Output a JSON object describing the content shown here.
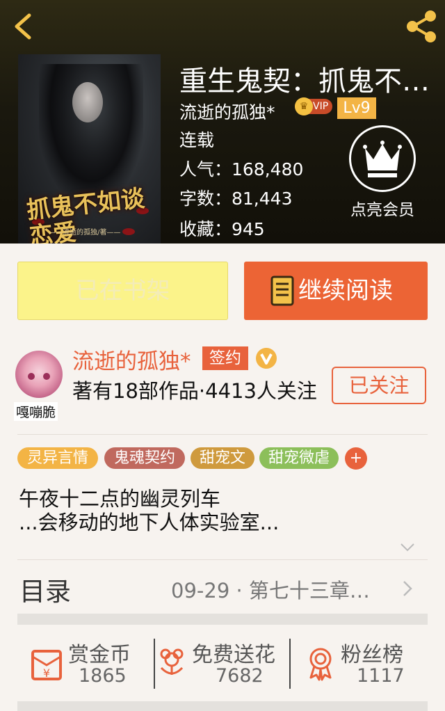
{
  "header": {
    "back_icon": "chevron-left-icon",
    "share_icon": "share-icon"
  },
  "book": {
    "title": "重生鬼契：抓鬼不…",
    "author": "流逝的孤独*",
    "vip_label": "VIP",
    "level": "Lv9",
    "status": "连载",
    "popularity": "人气：168,480",
    "word_count": "字数：81,443",
    "favorites": "收藏：945",
    "cover_title": "抓鬼不如谈恋爱",
    "cover_author": "——流逝的孤独/著——",
    "member_label": "点亮会员"
  },
  "actions": {
    "shelf_label": "已在书架",
    "read_label": "继续阅读"
  },
  "author_card": {
    "avatar_name": "嘎嘣脆",
    "name": "流逝的孤独*",
    "sign_label": "签约",
    "works_text": "著有18部作品·4413人关注",
    "follow_label": "已关注"
  },
  "tags": [
    {
      "label": "灵异言情",
      "color": "#f3b445"
    },
    {
      "label": "鬼魂契约",
      "color": "#c0695e"
    },
    {
      "label": "甜宠文",
      "color": "#cf9a3d"
    },
    {
      "label": "甜宠微虐",
      "color": "#8cbf5a"
    }
  ],
  "tag_more": "+",
  "description": {
    "line1": "午夜十二点的幽灵列车",
    "line2": "...会移动的地下人体实验室..."
  },
  "catalog": {
    "label": "目录",
    "latest": "09-29 · 第七十三章…"
  },
  "bottom_stats": [
    {
      "label": "赏金币",
      "value": "1865",
      "icon": "coin-envelope-icon"
    },
    {
      "label": "免费送花",
      "value": "7682",
      "icon": "flower-icon"
    },
    {
      "label": "粉丝榜",
      "value": "1117",
      "icon": "medal-icon"
    }
  ],
  "colors": {
    "accent": "#e8623c",
    "shelf_button": "#fbf38a",
    "level_badge": "#f3b445"
  }
}
